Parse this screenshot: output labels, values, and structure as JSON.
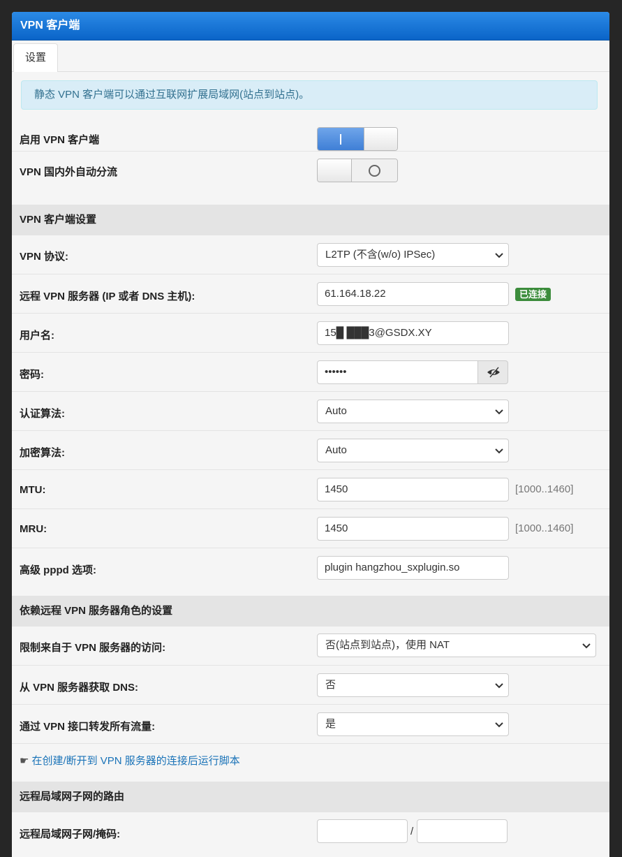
{
  "panel": {
    "title": "VPN 客户端"
  },
  "tabs": [
    {
      "label": "设置"
    }
  ],
  "info_alert": "静态 VPN 客户端可以通过互联网扩展局域网(站点到站点)。",
  "toggles": {
    "enable_vpn": {
      "label": "启用 VPN 客户端",
      "state": "on"
    },
    "auto_split": {
      "label": "VPN 国内外自动分流",
      "state": "off"
    }
  },
  "client_settings": {
    "header": "VPN 客户端设置",
    "protocol": {
      "label": "VPN 协议:",
      "value": "L2TP (不含(w/o) IPSec)"
    },
    "server": {
      "label": "远程 VPN 服务器 (IP 或者 DNS 主机):",
      "value": "61.164.18.22",
      "status": "已连接",
      "status_color": "#3c8c3c"
    },
    "username": {
      "label": "用户名:",
      "value": "15█ ███3@GSDX.XY"
    },
    "password": {
      "label": "密码:",
      "value": "••••••"
    },
    "auth_algo": {
      "label": "认证算法:",
      "value": "Auto"
    },
    "enc_algo": {
      "label": "加密算法:",
      "value": "Auto"
    },
    "mtu": {
      "label": "MTU:",
      "value": "1450",
      "hint": "[1000..1460]"
    },
    "mru": {
      "label": "MRU:",
      "value": "1450",
      "hint": "[1000..1460]"
    },
    "pppd": {
      "label": "高级 pppd 选项:",
      "value": "plugin hangzhou_sxplugin.so"
    }
  },
  "role_settings": {
    "header": "依赖远程 VPN 服务器角色的设置",
    "restrict_access": {
      "label": "限制来自于 VPN 服务器的访问:",
      "value": "否(站点到站点)，使用 NAT"
    },
    "get_dns": {
      "label": "从 VPN 服务器获取 DNS:",
      "value": "否"
    },
    "forward_all": {
      "label": "通过 VPN 接口转发所有流量:",
      "value": "是"
    },
    "script_link": "在创建/断开到 VPN 服务器的连接后运行脚本"
  },
  "routes": {
    "header": "远程局域网子网的路由",
    "subnet": {
      "label": "远程局域网子网/掩码:",
      "subnet_value": "",
      "mask_value": "",
      "separator": "/"
    }
  },
  "colors": {
    "header_blue": "#0a64c8",
    "toggle_on": "#3f7fd6",
    "link": "#1a73b8"
  }
}
